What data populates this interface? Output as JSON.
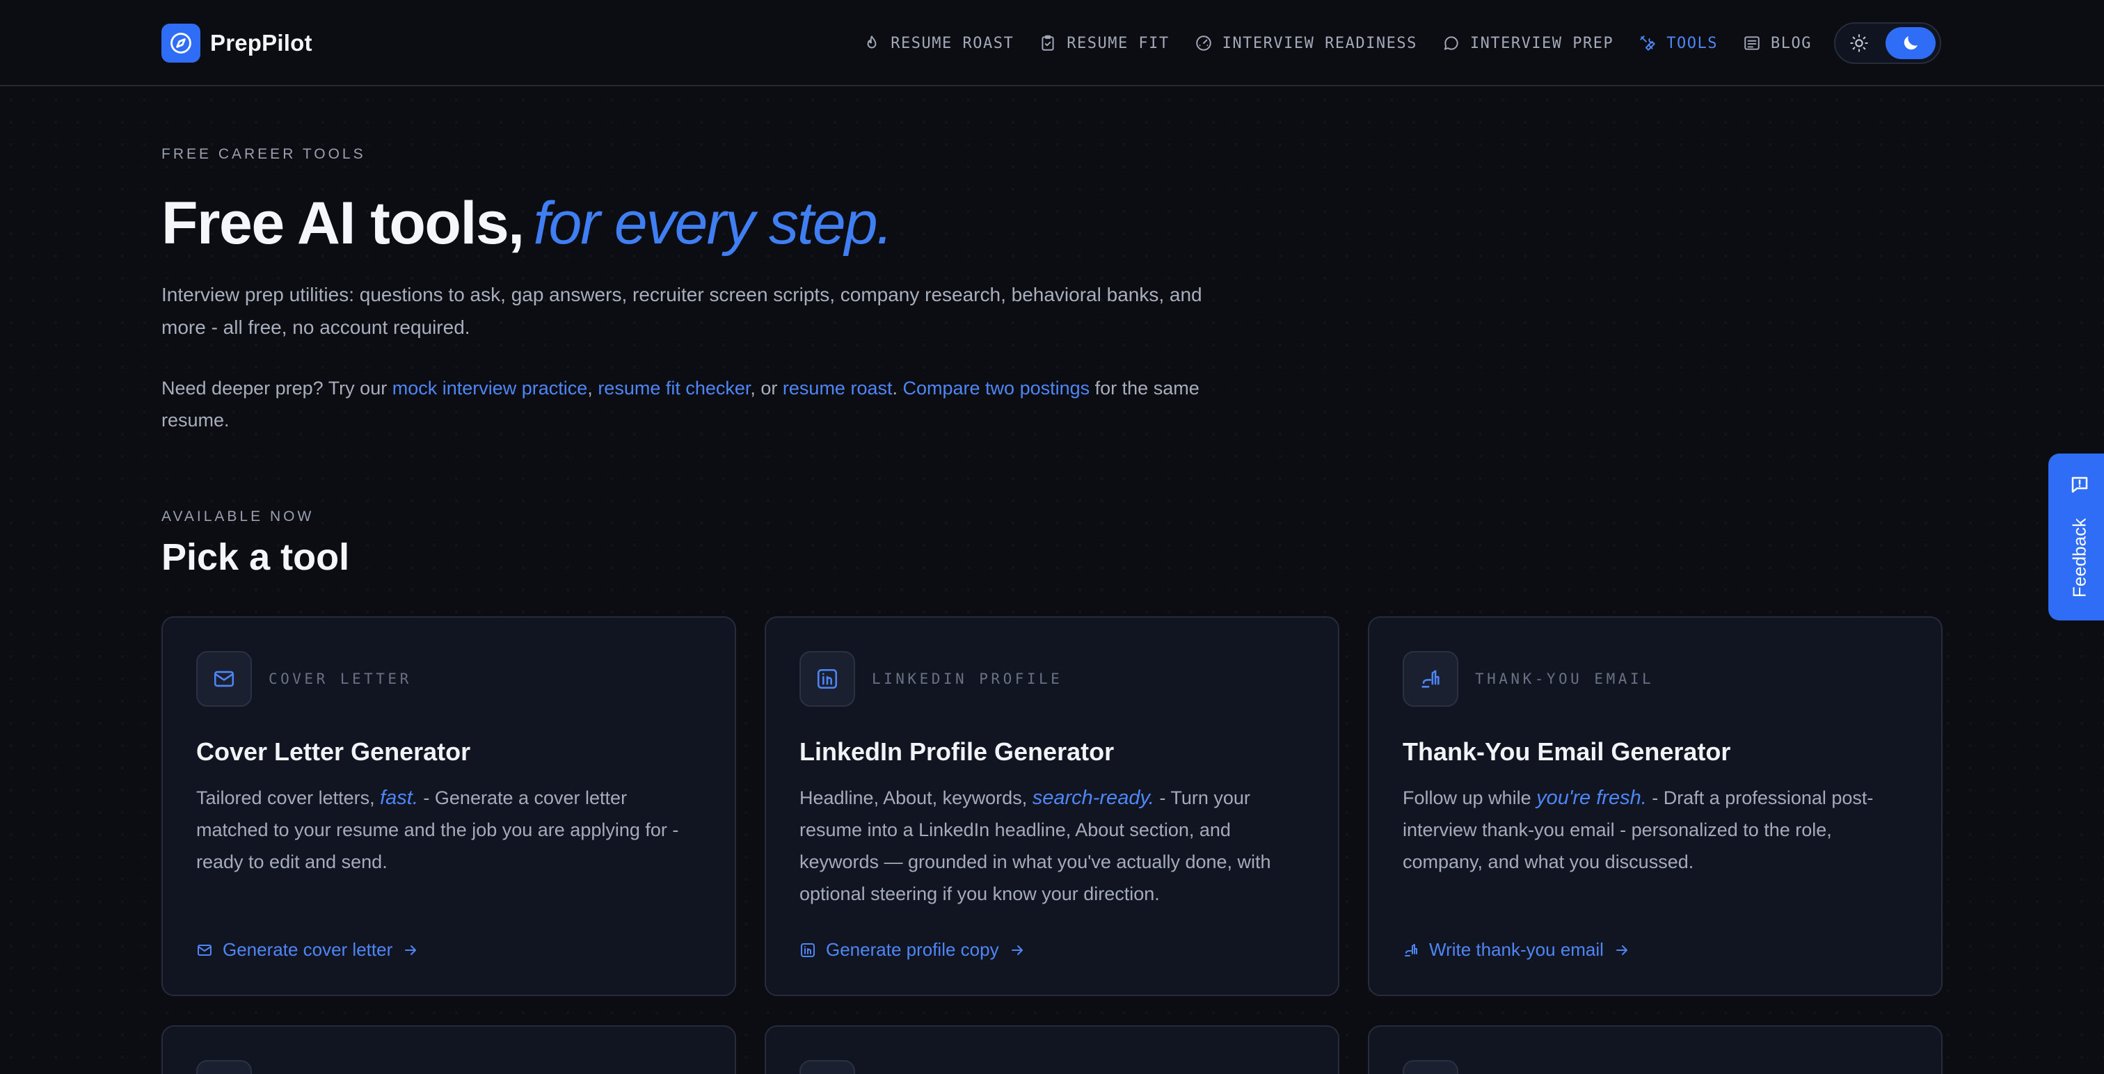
{
  "brand": {
    "name": "PrepPilot",
    "accent": "#2f6df6",
    "background": "#0b0d12"
  },
  "nav": {
    "items": [
      {
        "label": "RESUME ROAST",
        "icon": "flame-icon",
        "active": false
      },
      {
        "label": "RESUME FIT",
        "icon": "clipboard-check-icon",
        "active": false
      },
      {
        "label": "INTERVIEW READINESS",
        "icon": "gauge-icon",
        "active": false
      },
      {
        "label": "INTERVIEW PREP",
        "icon": "chat-bubble-icon",
        "active": false
      },
      {
        "label": "TOOLS",
        "icon": "tools-icon",
        "active": true
      },
      {
        "label": "BLOG",
        "icon": "newspaper-icon",
        "active": false
      }
    ],
    "theme": {
      "mode": "dark"
    }
  },
  "hero": {
    "eyebrow": "FREE CAREER TOOLS",
    "title_main": "Free AI tools,",
    "title_accent": "for every step.",
    "description": "Interview prep utilities: questions to ask, gap answers, recruiter screen scripts, company research, behavioral banks, and more - all free, no account required.",
    "links": {
      "prefix": "Need deeper prep? Try our ",
      "mock": "mock interview practice",
      "sep1": ", ",
      "fit": "resume fit checker",
      "sep2": ", or ",
      "roast": "resume roast",
      "sep3": ". ",
      "compare": "Compare two postings",
      "suffix": " for the same resume."
    }
  },
  "section": {
    "eyebrow": "AVAILABLE NOW",
    "title": "Pick a tool"
  },
  "cards": [
    {
      "tag": "COVER LETTER",
      "icon": "mail-icon",
      "title": "Cover Letter Generator",
      "lead": "Tailored cover letters, ",
      "highlight": "fast.",
      "body": " - Generate a cover letter matched to your resume and the job you are applying for - ready to edit and send.",
      "cta": "Generate cover letter"
    },
    {
      "tag": "LINKEDIN PROFILE",
      "icon": "linkedin-icon",
      "title": "LinkedIn Profile Generator",
      "lead": "Headline, About, keywords, ",
      "highlight": "search-ready.",
      "body": " - Turn your resume into a LinkedIn headline, About section, and keywords — grounded in what you've actually done, with optional steering if you know your direction.",
      "cta": "Generate profile copy"
    },
    {
      "tag": "THANK-YOU EMAIL",
      "icon": "hand-wave-icon",
      "title": "Thank-You Email Generator",
      "lead": "Follow up while ",
      "highlight": "you're fresh.",
      "body": " - Draft a professional post-interview thank-you email - personalized to the role, company, and what you discussed.",
      "cta": "Write thank-you email"
    }
  ],
  "feedback": {
    "label": "Feedback"
  }
}
